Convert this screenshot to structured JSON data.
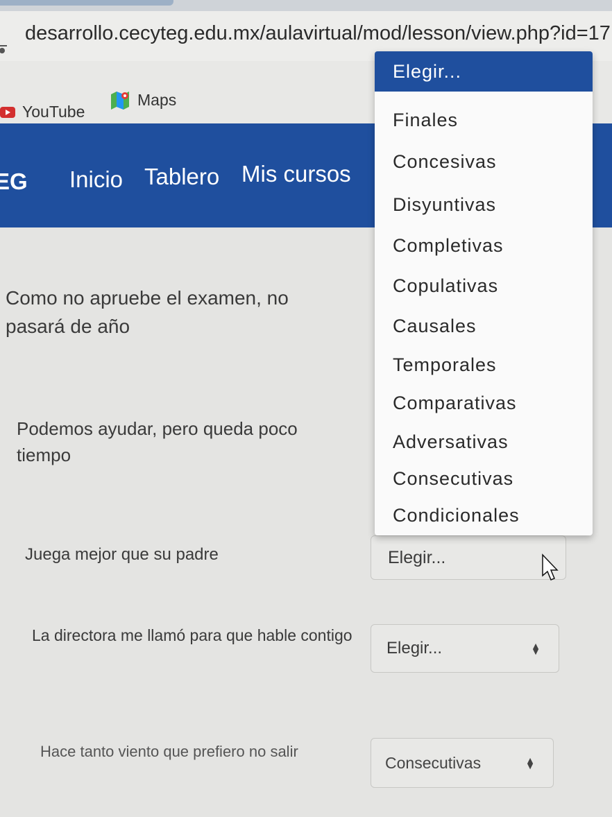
{
  "browser": {
    "url": "desarrollo.cecyteg.edu.mx/aulavirtual/mod/lesson/view.php?id=17"
  },
  "bookmarks": [
    {
      "label": "YouTube",
      "icon": "youtube-icon"
    },
    {
      "label": "Maps",
      "icon": "maps-icon"
    }
  ],
  "nav": {
    "logo": "EG",
    "items": [
      "Inicio",
      "Tablero",
      "Mis cursos"
    ]
  },
  "questions": [
    {
      "text": "Como no apruebe el examen, no pasará de año"
    },
    {
      "text": "Podemos ayudar, pero queda poco tiempo"
    },
    {
      "text": "Juega mejor que su padre",
      "selected": "Elegir..."
    },
    {
      "text": "La directora me llamó para que hable contigo",
      "selected": "Elegir..."
    },
    {
      "text": "Hace tanto viento que prefiero no salir",
      "selected": "Consecutivas"
    }
  ],
  "dropdown": {
    "options": [
      "Elegir...",
      "Finales",
      "Concesivas",
      "Disyuntivas",
      "Completivas",
      "Copulativas",
      "Causales",
      "Temporales",
      "Comparativas",
      "Adversativas",
      "Consecutivas",
      "Condicionales"
    ],
    "highlighted": "Elegir..."
  },
  "colors": {
    "navbar": "#1f4f9e",
    "highlight": "#1f4f9e"
  }
}
